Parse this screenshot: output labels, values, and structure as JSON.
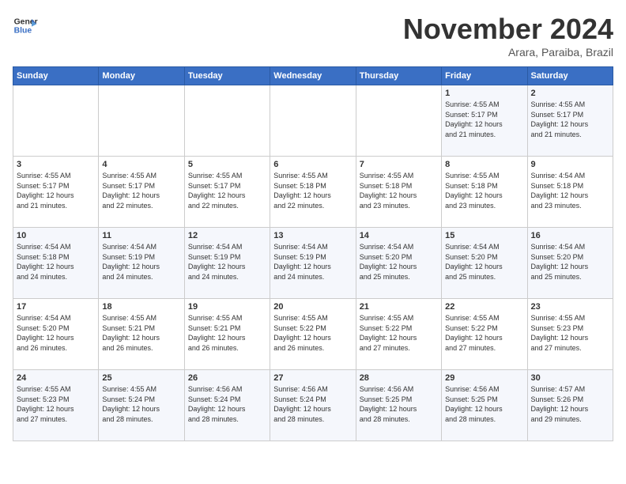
{
  "header": {
    "logo": {
      "line1": "General",
      "line2": "Blue"
    },
    "month": "November 2024",
    "location": "Arara, Paraiba, Brazil"
  },
  "weekdays": [
    "Sunday",
    "Monday",
    "Tuesday",
    "Wednesday",
    "Thursday",
    "Friday",
    "Saturday"
  ],
  "weeks": [
    [
      {
        "day": "",
        "info": ""
      },
      {
        "day": "",
        "info": ""
      },
      {
        "day": "",
        "info": ""
      },
      {
        "day": "",
        "info": ""
      },
      {
        "day": "",
        "info": ""
      },
      {
        "day": "1",
        "info": "Sunrise: 4:55 AM\nSunset: 5:17 PM\nDaylight: 12 hours\nand 21 minutes."
      },
      {
        "day": "2",
        "info": "Sunrise: 4:55 AM\nSunset: 5:17 PM\nDaylight: 12 hours\nand 21 minutes."
      }
    ],
    [
      {
        "day": "3",
        "info": "Sunrise: 4:55 AM\nSunset: 5:17 PM\nDaylight: 12 hours\nand 21 minutes."
      },
      {
        "day": "4",
        "info": "Sunrise: 4:55 AM\nSunset: 5:17 PM\nDaylight: 12 hours\nand 22 minutes."
      },
      {
        "day": "5",
        "info": "Sunrise: 4:55 AM\nSunset: 5:17 PM\nDaylight: 12 hours\nand 22 minutes."
      },
      {
        "day": "6",
        "info": "Sunrise: 4:55 AM\nSunset: 5:18 PM\nDaylight: 12 hours\nand 22 minutes."
      },
      {
        "day": "7",
        "info": "Sunrise: 4:55 AM\nSunset: 5:18 PM\nDaylight: 12 hours\nand 23 minutes."
      },
      {
        "day": "8",
        "info": "Sunrise: 4:55 AM\nSunset: 5:18 PM\nDaylight: 12 hours\nand 23 minutes."
      },
      {
        "day": "9",
        "info": "Sunrise: 4:54 AM\nSunset: 5:18 PM\nDaylight: 12 hours\nand 23 minutes."
      }
    ],
    [
      {
        "day": "10",
        "info": "Sunrise: 4:54 AM\nSunset: 5:18 PM\nDaylight: 12 hours\nand 24 minutes."
      },
      {
        "day": "11",
        "info": "Sunrise: 4:54 AM\nSunset: 5:19 PM\nDaylight: 12 hours\nand 24 minutes."
      },
      {
        "day": "12",
        "info": "Sunrise: 4:54 AM\nSunset: 5:19 PM\nDaylight: 12 hours\nand 24 minutes."
      },
      {
        "day": "13",
        "info": "Sunrise: 4:54 AM\nSunset: 5:19 PM\nDaylight: 12 hours\nand 24 minutes."
      },
      {
        "day": "14",
        "info": "Sunrise: 4:54 AM\nSunset: 5:20 PM\nDaylight: 12 hours\nand 25 minutes."
      },
      {
        "day": "15",
        "info": "Sunrise: 4:54 AM\nSunset: 5:20 PM\nDaylight: 12 hours\nand 25 minutes."
      },
      {
        "day": "16",
        "info": "Sunrise: 4:54 AM\nSunset: 5:20 PM\nDaylight: 12 hours\nand 25 minutes."
      }
    ],
    [
      {
        "day": "17",
        "info": "Sunrise: 4:54 AM\nSunset: 5:20 PM\nDaylight: 12 hours\nand 26 minutes."
      },
      {
        "day": "18",
        "info": "Sunrise: 4:55 AM\nSunset: 5:21 PM\nDaylight: 12 hours\nand 26 minutes."
      },
      {
        "day": "19",
        "info": "Sunrise: 4:55 AM\nSunset: 5:21 PM\nDaylight: 12 hours\nand 26 minutes."
      },
      {
        "day": "20",
        "info": "Sunrise: 4:55 AM\nSunset: 5:22 PM\nDaylight: 12 hours\nand 26 minutes."
      },
      {
        "day": "21",
        "info": "Sunrise: 4:55 AM\nSunset: 5:22 PM\nDaylight: 12 hours\nand 27 minutes."
      },
      {
        "day": "22",
        "info": "Sunrise: 4:55 AM\nSunset: 5:22 PM\nDaylight: 12 hours\nand 27 minutes."
      },
      {
        "day": "23",
        "info": "Sunrise: 4:55 AM\nSunset: 5:23 PM\nDaylight: 12 hours\nand 27 minutes."
      }
    ],
    [
      {
        "day": "24",
        "info": "Sunrise: 4:55 AM\nSunset: 5:23 PM\nDaylight: 12 hours\nand 27 minutes."
      },
      {
        "day": "25",
        "info": "Sunrise: 4:55 AM\nSunset: 5:24 PM\nDaylight: 12 hours\nand 28 minutes."
      },
      {
        "day": "26",
        "info": "Sunrise: 4:56 AM\nSunset: 5:24 PM\nDaylight: 12 hours\nand 28 minutes."
      },
      {
        "day": "27",
        "info": "Sunrise: 4:56 AM\nSunset: 5:24 PM\nDaylight: 12 hours\nand 28 minutes."
      },
      {
        "day": "28",
        "info": "Sunrise: 4:56 AM\nSunset: 5:25 PM\nDaylight: 12 hours\nand 28 minutes."
      },
      {
        "day": "29",
        "info": "Sunrise: 4:56 AM\nSunset: 5:25 PM\nDaylight: 12 hours\nand 28 minutes."
      },
      {
        "day": "30",
        "info": "Sunrise: 4:57 AM\nSunset: 5:26 PM\nDaylight: 12 hours\nand 29 minutes."
      }
    ]
  ]
}
